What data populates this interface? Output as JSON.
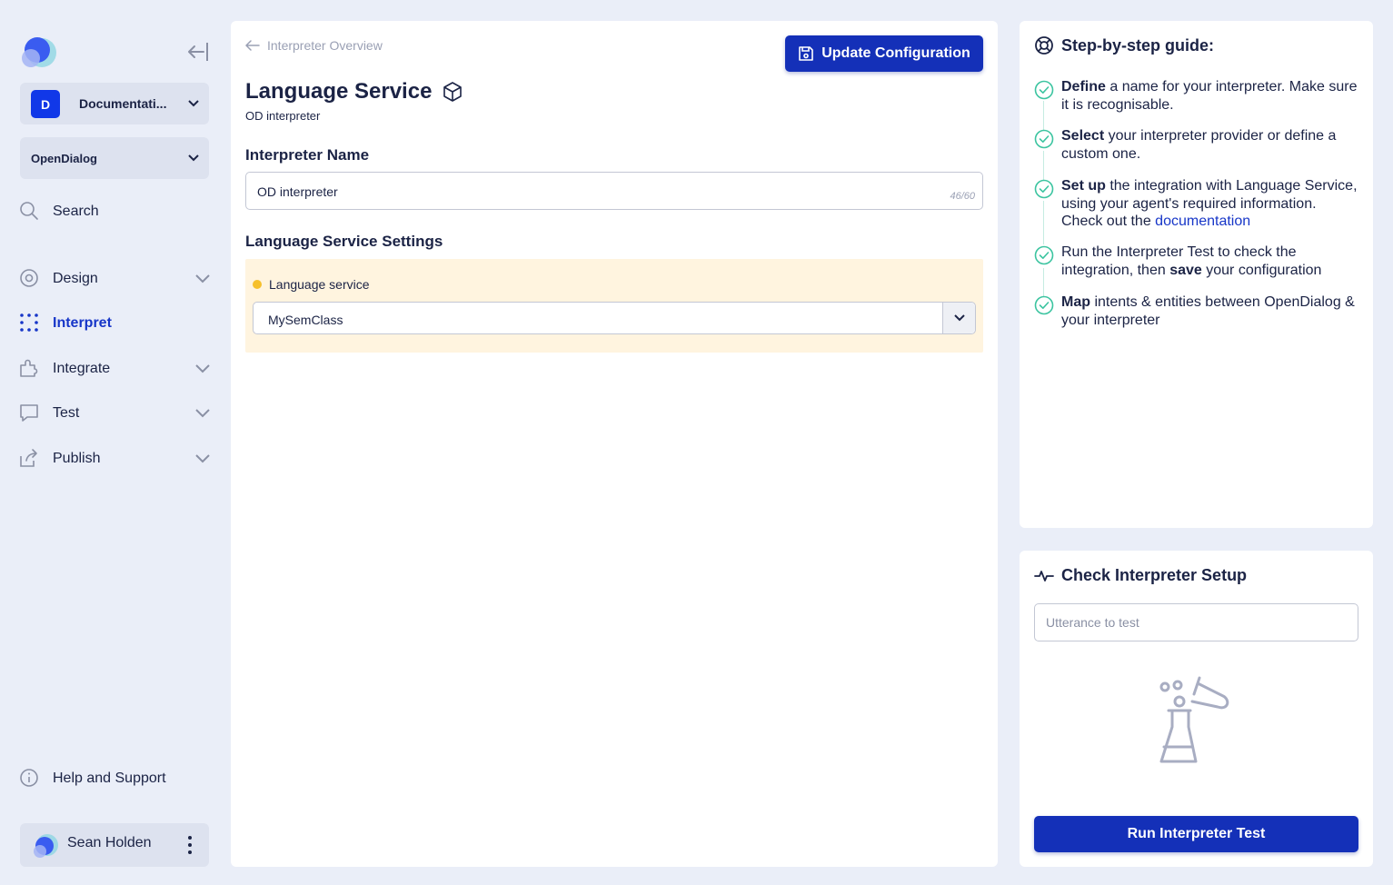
{
  "sidebar": {
    "workspace": {
      "badge": "D",
      "label": "Documentati..."
    },
    "project": {
      "label": "OpenDialog"
    },
    "search_label": "Search",
    "nav": [
      {
        "label": "Design"
      },
      {
        "label": "Interpret"
      },
      {
        "label": "Integrate"
      },
      {
        "label": "Test"
      },
      {
        "label": "Publish"
      }
    ],
    "help_label": "Help and Support",
    "user_name": "Sean Holden"
  },
  "main": {
    "back_label": "Interpreter Overview",
    "update_button": "Update Configuration",
    "title": "Language Service",
    "subtitle": "OD interpreter",
    "name_section": {
      "label": "Interpreter Name",
      "value": "OD interpreter",
      "counter": "46/60"
    },
    "settings_section": {
      "label": "Language Service Settings",
      "field_label": "Language service",
      "selected": "MySemClass"
    }
  },
  "guide": {
    "title": "Step-by-step guide:",
    "steps": [
      {
        "bold": "Define",
        "text": " a name for your interpreter. Make sure it is recognisable."
      },
      {
        "bold": "Select",
        "text": " your interpreter provider or define a custom one."
      },
      {
        "bold": "Set up",
        "text": " the integration with Language Service, using your agent's required information. Check out the ",
        "link": "documentation"
      },
      {
        "pre": "Run the Interpreter Test to check the integration, then ",
        "bold": "save",
        "text": " your configuration"
      },
      {
        "bold": "Map",
        "text": " intents & entities between OpenDialog & your interpreter"
      }
    ]
  },
  "check": {
    "title": "Check Interpreter Setup",
    "placeholder": "Utterance to test",
    "run_button": "Run Interpreter Test"
  },
  "colors": {
    "accent": "#1430b8",
    "background": "#eaeef8",
    "warning": "#f6c02c",
    "success": "#3cc4a0"
  }
}
